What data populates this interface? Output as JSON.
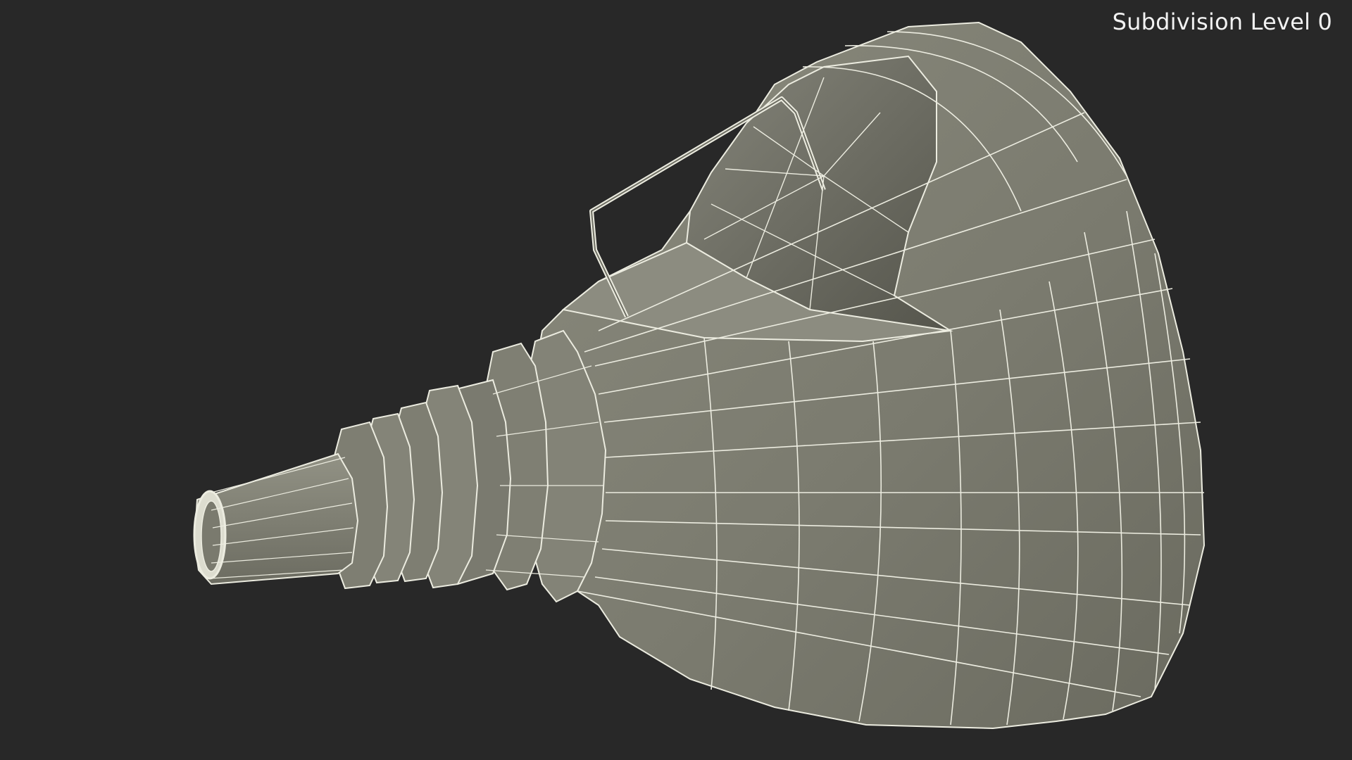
{
  "viewport": {
    "background": "#282828",
    "subdivision_label": "Subdivision Level 0"
  },
  "model": {
    "subject": "funnel",
    "display": "wireframe-on-shaded",
    "surface_color": "#7d7d70",
    "wire_color": "#ecece0",
    "shadow_color": "#5f5f55"
  }
}
